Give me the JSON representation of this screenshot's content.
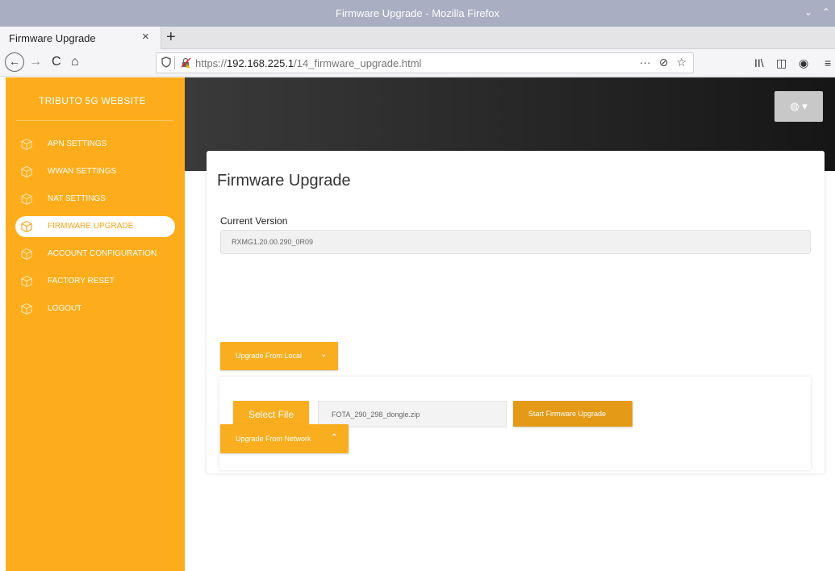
{
  "window": {
    "title": "Firmware Upgrade - Mozilla Firefox",
    "controls": [
      "⌄",
      "⌃"
    ]
  },
  "tab": {
    "label": "Firmware Upgrade",
    "close": "×",
    "new_tab": "+"
  },
  "nav": {
    "back": "←",
    "forward": "→",
    "reload": "C",
    "home": "⌂",
    "url_prefix": "https://",
    "url_host": "192.168.225.1",
    "url_path": "/14_firmware_upgrade.html",
    "page_actions": "···",
    "pocket": "⊘",
    "bookmark": "☆",
    "library": "II\\",
    "sidebar_toggle": "◫",
    "account": "◉",
    "menu": "≡"
  },
  "site": {
    "brand": "TRIBUTO 5G WEBSITE",
    "accent_color": "#fdad1b",
    "menu": [
      {
        "label": "APN SETTINGS",
        "active": false
      },
      {
        "label": "WWAN SETTINGS",
        "active": false
      },
      {
        "label": "NAT SETTINGS",
        "active": false
      },
      {
        "label": "FIRMWARE UPGRADE",
        "active": true
      },
      {
        "label": "ACCOUNT CONFIGURATION",
        "active": false
      },
      {
        "label": "FACTORY RESET",
        "active": false
      },
      {
        "label": "LOGOUT",
        "active": false
      }
    ],
    "language_button": "◍ ▾"
  },
  "main": {
    "title": "Firmware Upgrade",
    "current_version_label": "Current Version",
    "current_version_value": "RXMG1.20.00.290_0R09",
    "upgrade_local": {
      "label": "Upgrade From Local",
      "chevron": "⌄"
    },
    "select_file_label": "Select File",
    "selected_file": "FOTA_290_298_dongle.zip",
    "start_label": "Start Firmware Upgrade",
    "upgrade_network": {
      "label": "Upgrade From Network",
      "chevron": "⌃"
    }
  }
}
